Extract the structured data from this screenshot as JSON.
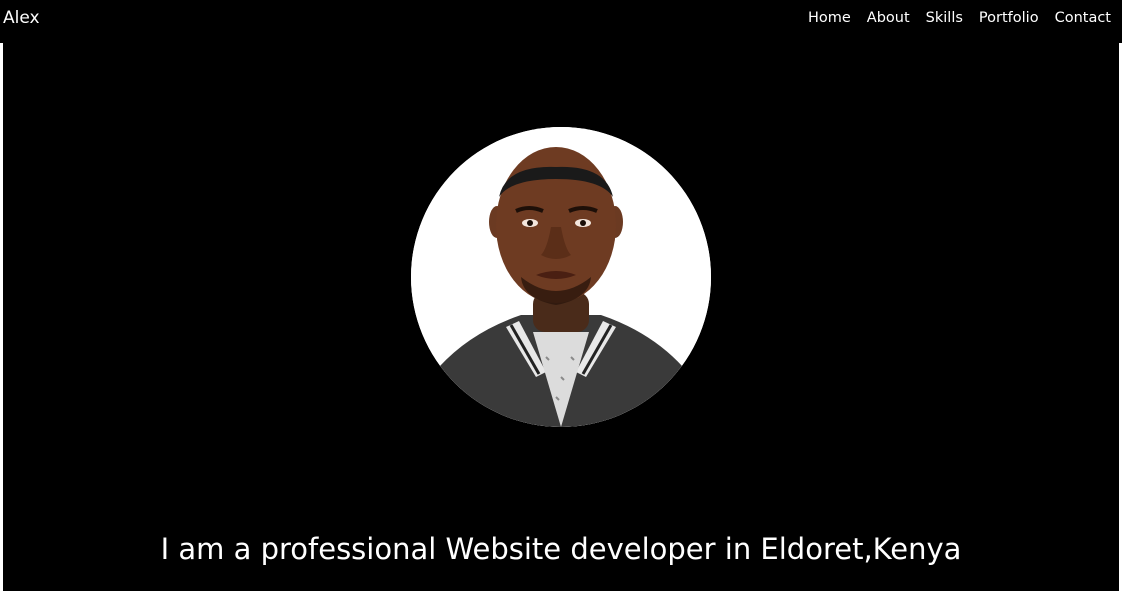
{
  "navbar": {
    "brand": "Alex",
    "links": [
      {
        "label": "Home"
      },
      {
        "label": "About"
      },
      {
        "label": "Skills"
      },
      {
        "label": "Portfolio"
      },
      {
        "label": "Contact"
      }
    ]
  },
  "hero": {
    "tagline": "I am a professional Website developer in Eldoret,Kenya",
    "avatar_icon": "profile-photo"
  },
  "colors": {
    "background": "#000000",
    "text": "#ffffff",
    "avatar_bg": "#ffffff"
  }
}
